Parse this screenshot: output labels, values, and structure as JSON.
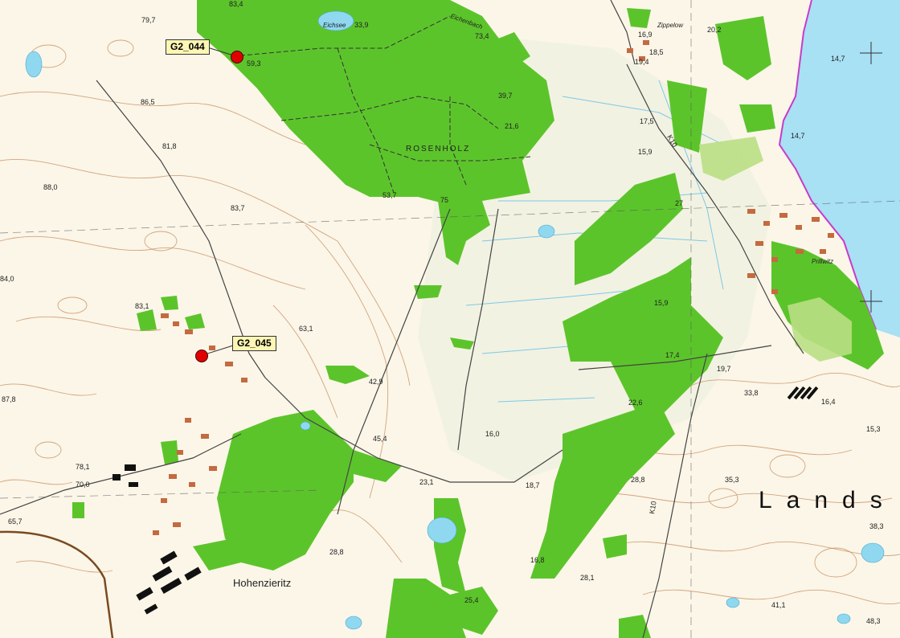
{
  "markers": [
    {
      "id": "G2_044",
      "label": "G2_044",
      "elevation": "59,3"
    },
    {
      "id": "G2_045",
      "label": "G2_045",
      "elevation": "63,1"
    }
  ],
  "places": {
    "forest": "ROSENHOLZ",
    "lake": "Eichsee",
    "stream": "Eichenbach",
    "village_nw": "Zippelow",
    "village_e": "Prillwitz",
    "town": "Hohenzieritz",
    "region": "Lands",
    "road_1": "K10",
    "road_2": "K10"
  },
  "elevations": [
    "79,7",
    "83,4",
    "33,9",
    "73,4",
    "16,9",
    "18,5",
    "19,4",
    "20,2",
    "14,7",
    "14,7",
    "86,5",
    "81,8",
    "88,0",
    "83,7",
    "53,7",
    "39,7",
    "21,6",
    "17,5",
    "15,9",
    "27",
    "75",
    "59,3",
    "84,0",
    "83,1",
    "63,1",
    "42,9",
    "45,4",
    "23,1",
    "18,7",
    "16,0",
    "16,8",
    "17,4",
    "15,9",
    "19,7",
    "33,8",
    "16,4",
    "15,3",
    "22,6",
    "28,8",
    "35,3",
    "38,3",
    "41,1",
    "48,3",
    "78,1",
    "70,0",
    "65,7",
    "28,8",
    "25,4",
    "28,1",
    "87,8"
  ],
  "colors": {
    "forest": "#5cc42b",
    "water": "#a8e0f4",
    "lake": "#8fd8f0",
    "paper": "#fbf6e8",
    "contour": "#c8895a",
    "marker": "#e00000",
    "border": "#c83cc8"
  }
}
